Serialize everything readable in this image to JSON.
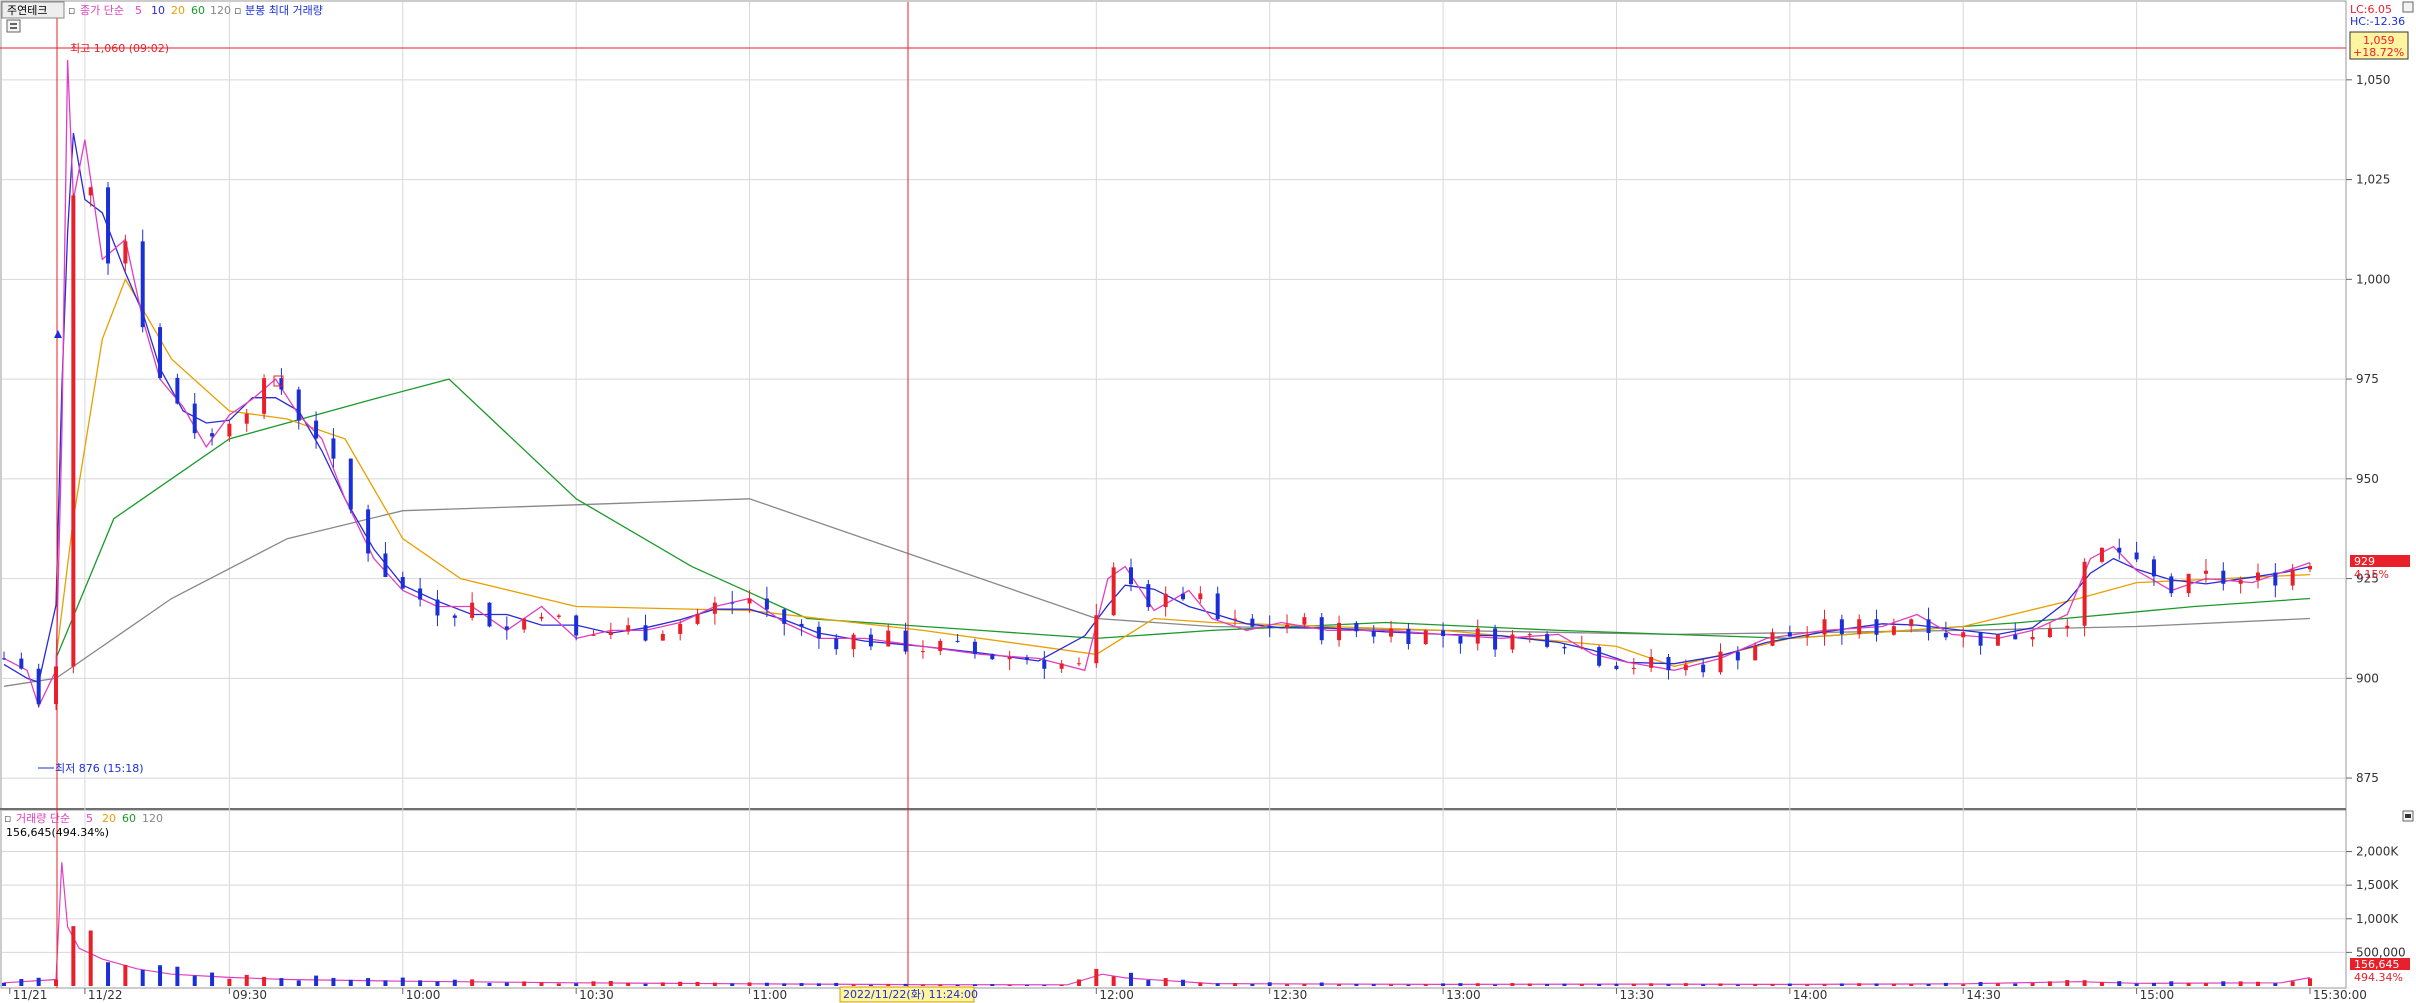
{
  "title": "주연테크",
  "toolbar": {
    "price_legend": {
      "prefix": "종가 단순",
      "ma": [
        "5",
        "10",
        "20",
        "60",
        "120"
      ],
      "extra": "분봉 최대 거래량"
    },
    "volume_legend": {
      "prefix": "거래량 단순",
      "ma": [
        "5",
        "20",
        "60",
        "120"
      ]
    },
    "volume_info": "156,645(494.34%)"
  },
  "colors": {
    "up": "#e8202a",
    "down": "#1a2fd6",
    "ma5": "#e040c0",
    "ma10": "#2a2ad6",
    "ma20": "#e8a000",
    "ma60": "#1a9a2a",
    "ma120": "#888888",
    "grid": "#d8d8d8",
    "marker": "#e8202a"
  },
  "right_panel": {
    "lc": "LC:6.05",
    "hc": "HC:-12.36",
    "top_box_price": "1,059",
    "top_box_pct": "+18.72%",
    "current_price": "929",
    "current_pct": "4.15%",
    "volume_box": "156,645",
    "volume_pct": "494.34%"
  },
  "annotations": {
    "high": "최고 1,060 (09:02)",
    "low": "최저 876 (15:18)",
    "crosshair_time": "2022/11/22(화) 11:24:00"
  },
  "chart_data": {
    "type": "candlestick",
    "price_axis": {
      "ticks": [
        875,
        900,
        925,
        950,
        975,
        1000,
        1025,
        1050
      ],
      "tick_labels": [
        "875",
        "900",
        "925",
        "950",
        "975",
        "1,000",
        "1,025",
        "1,050"
      ],
      "ylim": [
        868,
        1068
      ]
    },
    "volume_axis": {
      "ticks": [
        500000,
        1000000,
        1500000,
        2000000
      ],
      "tick_labels": [
        "500,000",
        "1,000K",
        "1,500K",
        "2,000K"
      ],
      "ylim": [
        0,
        2350000
      ]
    },
    "x_labels": [
      {
        "label": "11/21",
        "t": -8
      },
      {
        "label": "11/22",
        "t": 5
      },
      {
        "label": "09:30",
        "t": 30
      },
      {
        "label": "10:00",
        "t": 60
      },
      {
        "label": "10:30",
        "t": 90
      },
      {
        "label": "11:00",
        "t": 120
      },
      {
        "label": "12:00",
        "t": 180
      },
      {
        "label": "12:30",
        "t": 210
      },
      {
        "label": "13:00",
        "t": 240
      },
      {
        "label": "13:30",
        "t": 270
      },
      {
        "label": "14:00",
        "t": 300
      },
      {
        "label": "14:30",
        "t": 330
      },
      {
        "label": "15:00",
        "t": 360
      },
      {
        "label": "15:30:00",
        "t": 390
      }
    ],
    "price_keypoints": [
      [
        -9,
        905
      ],
      [
        -5,
        902
      ],
      [
        -3,
        893
      ],
      [
        0,
        902
      ],
      [
        1,
        960
      ],
      [
        2,
        1055
      ],
      [
        3,
        1020
      ],
      [
        5,
        1035
      ],
      [
        8,
        1005
      ],
      [
        12,
        1010
      ],
      [
        15,
        990
      ],
      [
        18,
        975
      ],
      [
        22,
        968
      ],
      [
        26,
        958
      ],
      [
        30,
        966
      ],
      [
        34,
        970
      ],
      [
        38,
        975
      ],
      [
        42,
        966
      ],
      [
        46,
        960
      ],
      [
        50,
        945
      ],
      [
        55,
        930
      ],
      [
        60,
        922
      ],
      [
        66,
        918
      ],
      [
        72,
        918
      ],
      [
        78,
        912
      ],
      [
        84,
        918
      ],
      [
        90,
        910
      ],
      [
        96,
        912
      ],
      [
        102,
        912
      ],
      [
        108,
        914
      ],
      [
        114,
        918
      ],
      [
        120,
        920
      ],
      [
        126,
        914
      ],
      [
        132,
        910
      ],
      [
        140,
        910
      ],
      [
        150,
        908
      ],
      [
        160,
        906
      ],
      [
        170,
        905
      ],
      [
        178,
        902
      ],
      [
        182,
        925
      ],
      [
        185,
        928
      ],
      [
        190,
        917
      ],
      [
        196,
        922
      ],
      [
        200,
        915
      ],
      [
        206,
        912
      ],
      [
        212,
        914
      ],
      [
        220,
        912
      ],
      [
        230,
        912
      ],
      [
        240,
        911
      ],
      [
        250,
        910
      ],
      [
        260,
        911
      ],
      [
        266,
        906
      ],
      [
        272,
        904
      ],
      [
        280,
        902
      ],
      [
        288,
        905
      ],
      [
        296,
        910
      ],
      [
        306,
        912
      ],
      [
        316,
        913
      ],
      [
        322,
        916
      ],
      [
        328,
        911
      ],
      [
        336,
        910
      ],
      [
        342,
        912
      ],
      [
        348,
        916
      ],
      [
        352,
        930
      ],
      [
        356,
        933
      ],
      [
        360,
        927
      ],
      [
        366,
        922
      ],
      [
        372,
        925
      ],
      [
        380,
        924
      ],
      [
        386,
        927
      ],
      [
        390,
        929
      ]
    ],
    "volume_keypoints": [
      [
        -9,
        60000
      ],
      [
        0,
        120000
      ],
      [
        1,
        2300000
      ],
      [
        2,
        1100000
      ],
      [
        4,
        700000
      ],
      [
        8,
        500000
      ],
      [
        14,
        320000
      ],
      [
        20,
        220000
      ],
      [
        30,
        160000
      ],
      [
        40,
        120000
      ],
      [
        60,
        90000
      ],
      [
        90,
        60000
      ],
      [
        120,
        40000
      ],
      [
        150,
        25000
      ],
      [
        175,
        22000
      ],
      [
        181,
        220000
      ],
      [
        185,
        150000
      ],
      [
        200,
        45000
      ],
      [
        240,
        30000
      ],
      [
        270,
        35000
      ],
      [
        300,
        30000
      ],
      [
        330,
        40000
      ],
      [
        350,
        80000
      ],
      [
        360,
        50000
      ],
      [
        385,
        60000
      ],
      [
        390,
        156645
      ]
    ],
    "ma_lines": {
      "ma20": [
        [
          0,
          905
        ],
        [
          3,
          940
        ],
        [
          8,
          985
        ],
        [
          12,
          1000
        ],
        [
          20,
          980
        ],
        [
          30,
          967
        ],
        [
          40,
          965
        ],
        [
          50,
          960
        ],
        [
          60,
          935
        ],
        [
          70,
          925
        ],
        [
          90,
          918
        ],
        [
          120,
          917
        ],
        [
          150,
          912
        ],
        [
          180,
          906
        ],
        [
          190,
          915
        ],
        [
          200,
          914
        ],
        [
          240,
          912
        ],
        [
          270,
          908
        ],
        [
          280,
          903
        ],
        [
          300,
          910
        ],
        [
          330,
          913
        ],
        [
          350,
          920
        ],
        [
          360,
          924
        ],
        [
          390,
          926
        ]
      ],
      "ma60": [
        [
          0,
          905
        ],
        [
          10,
          940
        ],
        [
          30,
          960
        ],
        [
          55,
          970
        ],
        [
          68,
          975
        ],
        [
          90,
          945
        ],
        [
          110,
          928
        ],
        [
          130,
          915
        ],
        [
          160,
          912
        ],
        [
          180,
          910
        ],
        [
          200,
          912
        ],
        [
          230,
          914
        ],
        [
          260,
          912
        ],
        [
          300,
          910
        ],
        [
          340,
          914
        ],
        [
          370,
          918
        ],
        [
          390,
          920
        ]
      ],
      "ma120": [
        [
          -9,
          898
        ],
        [
          0,
          900
        ],
        [
          20,
          920
        ],
        [
          40,
          935
        ],
        [
          60,
          942
        ],
        [
          80,
          943
        ],
        [
          100,
          944
        ],
        [
          120,
          945
        ],
        [
          150,
          930
        ],
        [
          180,
          915
        ],
        [
          200,
          913
        ],
        [
          240,
          912
        ],
        [
          280,
          911
        ],
        [
          330,
          912
        ],
        [
          360,
          913
        ],
        [
          390,
          915
        ]
      ]
    }
  }
}
